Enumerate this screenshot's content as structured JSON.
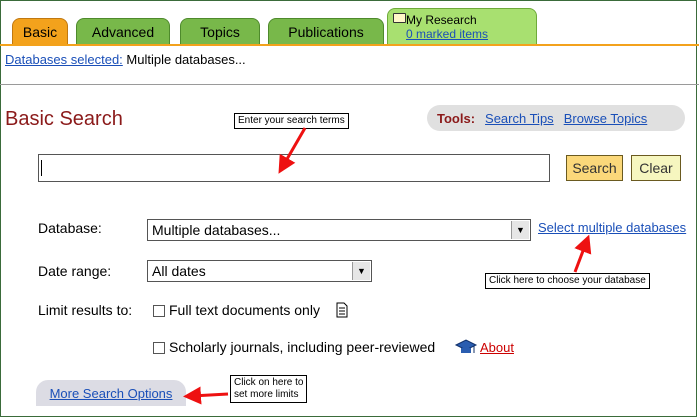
{
  "tabs": [
    {
      "label": "Basic",
      "active": true
    },
    {
      "label": "Advanced",
      "active": false
    },
    {
      "label": "Topics",
      "active": false
    },
    {
      "label": "Publications",
      "active": false
    }
  ],
  "research_tab": {
    "label": "My Research",
    "count": "0 marked items"
  },
  "databases_selected": {
    "link": "Databases selected:",
    "value": "Multiple databases..."
  },
  "page_title": "Basic Search",
  "callouts": {
    "search_terms": "Enter your search terms",
    "choose_db": "Click here to choose your database",
    "more_limits_1": "Click on here to",
    "more_limits_2": "set more limits"
  },
  "tools": {
    "label": "Tools:",
    "search_tips": "Search Tips",
    "browse_topics": "Browse Topics"
  },
  "search": {
    "value": "",
    "search_button": "Search",
    "clear_button": "Clear"
  },
  "database": {
    "label": "Database:",
    "selected": "Multiple databases...",
    "link": "Select multiple databases"
  },
  "date_range": {
    "label": "Date range:",
    "selected": "All dates"
  },
  "limits": {
    "label": "Limit results to:",
    "full_text": "Full text documents only",
    "scholarly": "Scholarly journals, including peer-reviewed",
    "about": "About"
  },
  "more_options": "More Search Options",
  "colors": {
    "tab_active": "#f3a21c",
    "tab": "#78b84a",
    "title": "#8b1a1a",
    "link": "#1a4fb8",
    "arrow": "#ee1111"
  }
}
